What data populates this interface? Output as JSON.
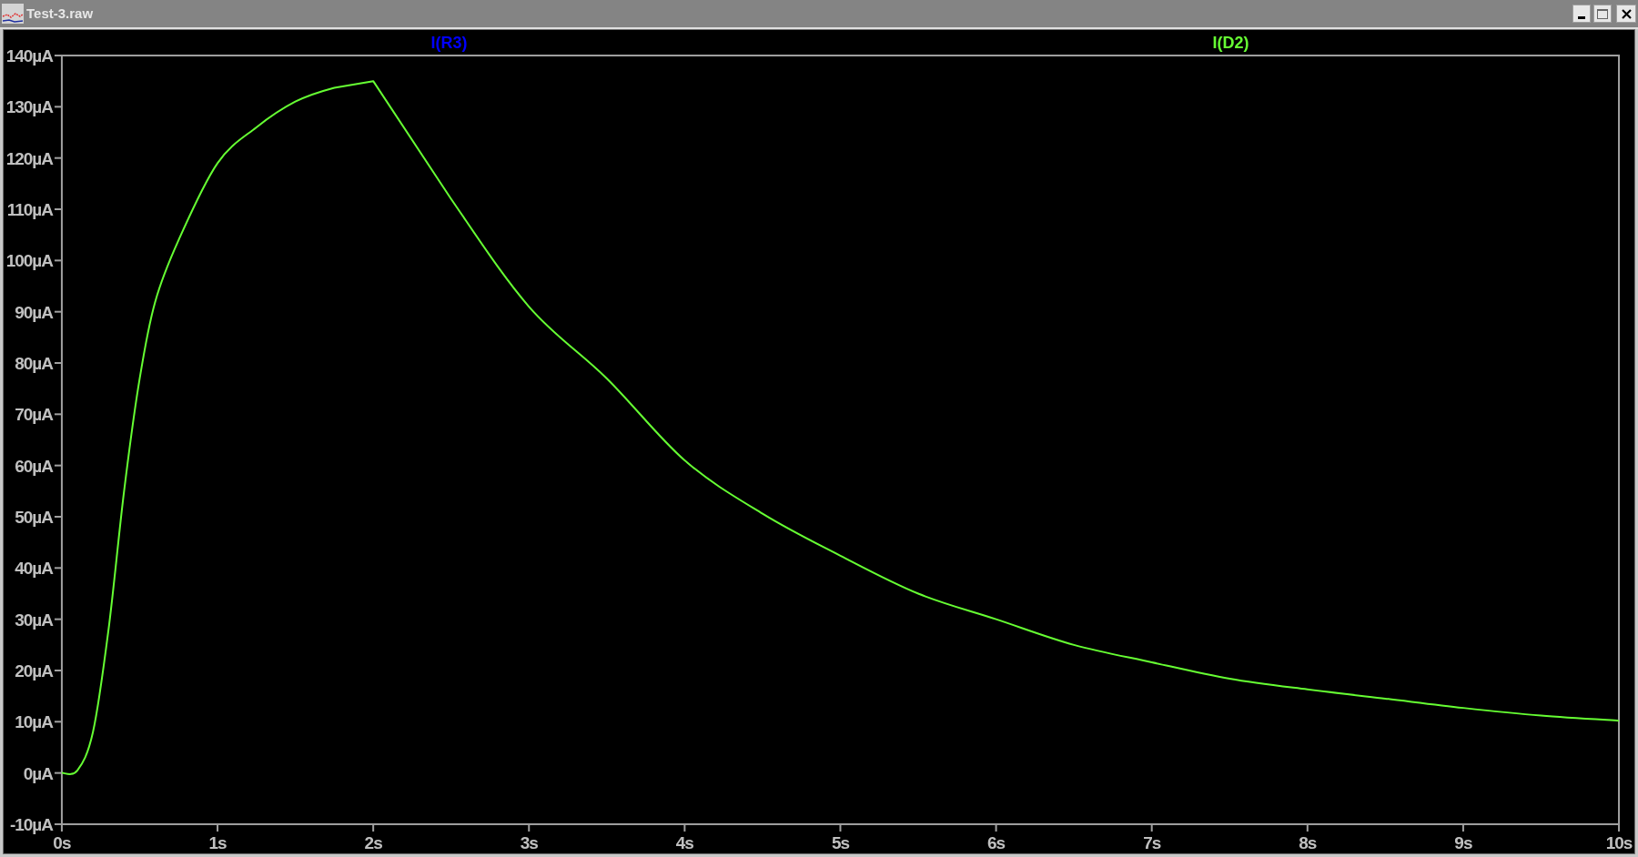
{
  "window": {
    "title": "Test-3.raw"
  },
  "plot": {
    "chart_data": {
      "type": "line",
      "x": [
        0,
        0.1,
        0.2,
        0.3,
        0.4,
        0.5,
        0.6,
        0.75,
        1,
        1.25,
        1.5,
        1.75,
        2,
        2.5,
        3,
        3.5,
        4,
        4.5,
        5,
        5.5,
        6,
        6.5,
        7,
        7.5,
        8,
        8.5,
        9,
        9.5,
        10
      ],
      "series": [
        {
          "name": "I(D2)",
          "color": "#66ff33",
          "values": [
            0,
            0.5,
            8,
            28,
            55,
            77,
            92,
            104,
            119,
            126,
            131,
            133.7,
            135,
            112,
            91,
            77,
            61,
            50.6,
            42.4,
            35,
            30,
            25,
            21.6,
            18.4,
            16.3,
            14.5,
            12.7,
            11.2,
            10.2
          ]
        }
      ],
      "xlim": [
        0,
        10
      ],
      "ylim": [
        -10,
        140
      ],
      "xticks": [
        {
          "value": 0,
          "label": "0s"
        },
        {
          "value": 1,
          "label": "1s"
        },
        {
          "value": 2,
          "label": "2s"
        },
        {
          "value": 3,
          "label": "3s"
        },
        {
          "value": 4,
          "label": "4s"
        },
        {
          "value": 5,
          "label": "5s"
        },
        {
          "value": 6,
          "label": "6s"
        },
        {
          "value": 7,
          "label": "7s"
        },
        {
          "value": 8,
          "label": "8s"
        },
        {
          "value": 9,
          "label": "9s"
        },
        {
          "value": 10,
          "label": "10s"
        }
      ],
      "yticks": [
        {
          "value": 140,
          "label": "140µA"
        },
        {
          "value": 130,
          "label": "130µA"
        },
        {
          "value": 120,
          "label": "120µA"
        },
        {
          "value": 110,
          "label": "110µA"
        },
        {
          "value": 100,
          "label": "100µA"
        },
        {
          "value": 90,
          "label": "90µA"
        },
        {
          "value": 80,
          "label": "80µA"
        },
        {
          "value": 70,
          "label": "70µA"
        },
        {
          "value": 60,
          "label": "60µA"
        },
        {
          "value": 50,
          "label": "50µA"
        },
        {
          "value": 40,
          "label": "40µA"
        },
        {
          "value": 30,
          "label": "30µA"
        },
        {
          "value": 20,
          "label": "20µA"
        },
        {
          "value": 10,
          "label": "10µA"
        },
        {
          "value": 0,
          "label": "0µA"
        },
        {
          "value": -10,
          "label": "-10µA"
        }
      ]
    },
    "legend": [
      {
        "name": "I(R3)",
        "color": "#0000ff"
      }
    ]
  }
}
